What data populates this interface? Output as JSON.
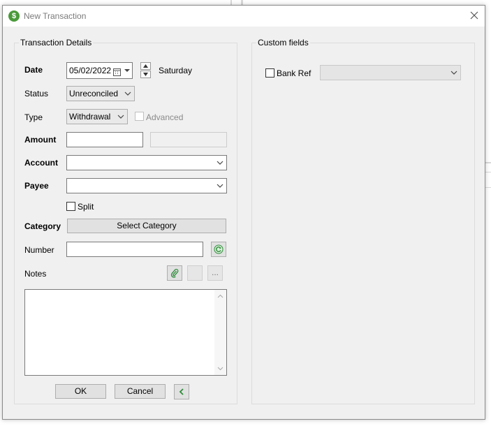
{
  "window": {
    "title": "New Transaction",
    "icon": "dollar-icon"
  },
  "details": {
    "legend": "Transaction Details",
    "date_label": "Date",
    "date_value": "05/02/2022",
    "weekday": "Saturday",
    "status_label": "Status",
    "status_value": "Unreconciled",
    "type_label": "Type",
    "type_value": "Withdrawal",
    "advanced_label": "Advanced",
    "amount_label": "Amount",
    "amount_value": "",
    "account_label": "Account",
    "account_value": "",
    "payee_label": "Payee",
    "payee_value": "",
    "split_label": "Split",
    "category_label": "Category",
    "category_button": "Select Category",
    "number_label": "Number",
    "number_value": "",
    "notes_label": "Notes",
    "notes_more": "...",
    "notes_value": ""
  },
  "custom": {
    "legend": "Custom fields",
    "bank_ref_label": "Bank Ref",
    "bank_ref_value": ""
  },
  "actions": {
    "ok": "OK",
    "cancel": "Cancel",
    "back": "<"
  },
  "colors": {
    "accent_green": "#2e8b3a",
    "window_bg": "#f0f0f0"
  }
}
